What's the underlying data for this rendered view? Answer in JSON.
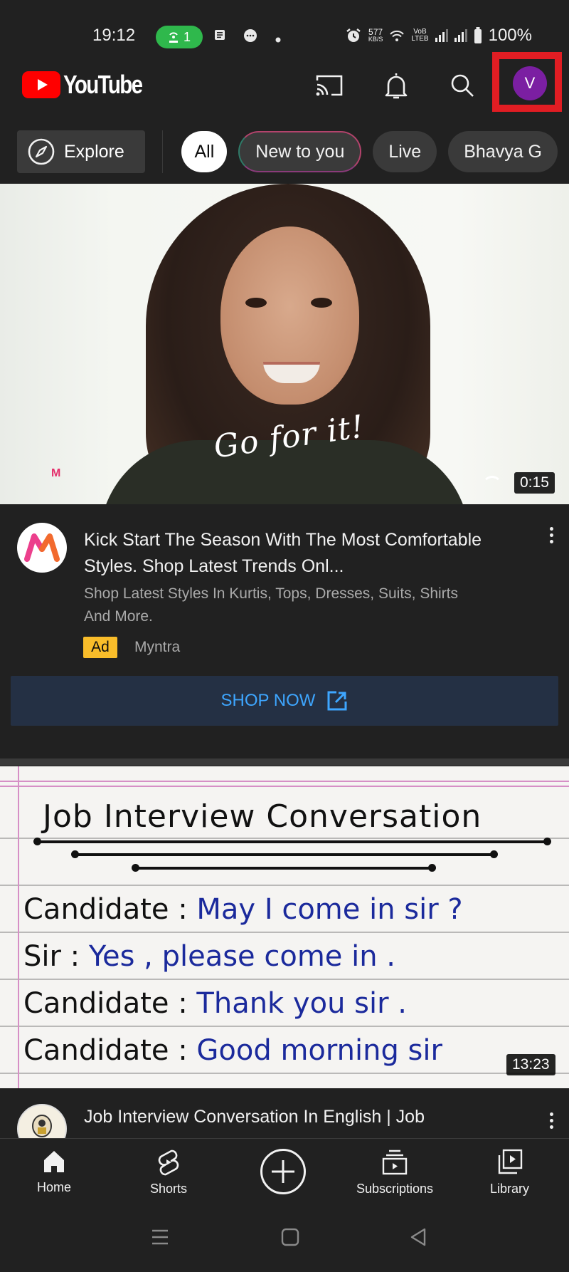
{
  "status_bar": {
    "time": "19:12",
    "hotspot_count": "1",
    "net_speed_value": "577",
    "net_speed_unit": "KB/S",
    "volte_top": "VoB",
    "volte_bottom": "LTEB",
    "battery": "100%"
  },
  "header": {
    "logo_text": "YouTube",
    "avatar_initial": "V",
    "highlight_color": "#e11d23",
    "avatar_color": "#7b1fa2"
  },
  "chips": {
    "explore_label": "Explore",
    "items": [
      {
        "label": "All",
        "active": true
      },
      {
        "label": "New to you",
        "active": false
      },
      {
        "label": "Live",
        "active": false
      },
      {
        "label": "Bhavya G",
        "active": false
      }
    ]
  },
  "ad_video": {
    "overlay_text": "Go for it!",
    "brand_watermark": "M",
    "duration": "0:15",
    "title": "Kick Start The Season With The Most Comfortable Styles. Shop Latest Trends Onl...",
    "description": "Shop Latest Styles In Kurtis, Tops, Dresses, Suits, Shirts And More.",
    "badge": "Ad",
    "channel": "Myntra",
    "cta_label": "SHOP NOW"
  },
  "video2": {
    "thumbnail": {
      "heading": "Job Interview Conversation",
      "lines": [
        {
          "speaker": "Candidate :",
          "text": "May I come in sir ?"
        },
        {
          "speaker": "Sir :",
          "text": "Yes , please come in ."
        },
        {
          "speaker": "Candidate :",
          "text": "Thank you sir ."
        },
        {
          "speaker": "Candidate :",
          "text": "Good morning sir"
        }
      ]
    },
    "duration": "13:23",
    "title": "Job Interview Conversation In English | Job"
  },
  "bottom_nav": {
    "items": [
      {
        "label": "Home",
        "active": true
      },
      {
        "label": "Shorts",
        "active": false
      },
      {
        "label": "Subscriptions",
        "active": false
      },
      {
        "label": "Library",
        "active": false
      }
    ]
  }
}
